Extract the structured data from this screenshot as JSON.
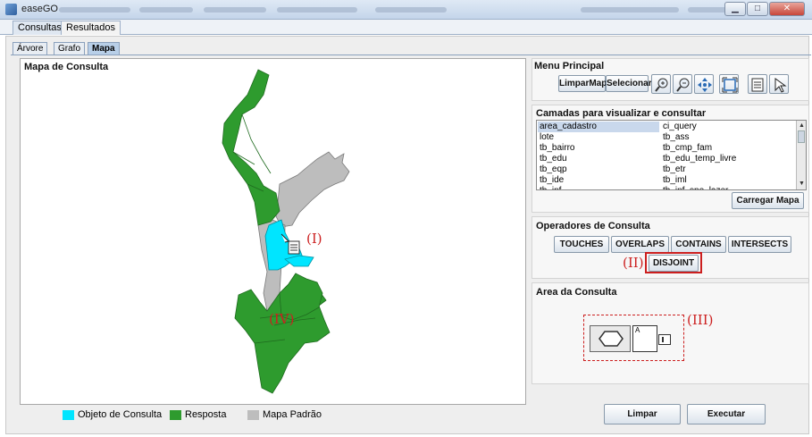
{
  "window": {
    "title": "easeGO"
  },
  "main_tabs": [
    {
      "label": "Consultas"
    },
    {
      "label": "Resultados"
    }
  ],
  "view_tabs": [
    {
      "label": "Árvore"
    },
    {
      "label": "Grafo"
    },
    {
      "label": "Mapa",
      "active": true
    }
  ],
  "map_panel": {
    "title": "Mapa de Consulta",
    "labels": {
      "query_object": "(I)",
      "answer": "(IV)"
    }
  },
  "legend": [
    {
      "label": "Objeto de Consulta",
      "color": "#00e5ff"
    },
    {
      "label": "Resposta",
      "color": "#2e9b2e"
    },
    {
      "label": "Mapa Padrão",
      "color": "#bdbdbd"
    }
  ],
  "menu_principal": {
    "title": "Menu Principal",
    "buttons": [
      {
        "label": "LimparMapa"
      },
      {
        "label": "Selecionar"
      }
    ],
    "tools": [
      {
        "icon": "zoom-in-icon"
      },
      {
        "icon": "zoom-out-icon"
      },
      {
        "icon": "pan-icon"
      },
      {
        "icon": "full-extent-icon"
      },
      {
        "icon": "layers-icon"
      },
      {
        "icon": "pointer-icon"
      }
    ]
  },
  "camadas": {
    "title": "Camadas para visualizar e consultar",
    "rows": [
      [
        "area_cadastro",
        "ci_query"
      ],
      [
        "lote",
        "tb_ass"
      ],
      [
        "tb_bairro",
        "tb_cmp_fam"
      ],
      [
        "tb_edu",
        "tb_edu_temp_livre"
      ],
      [
        "tb_eqp",
        "tb_etr"
      ],
      [
        "tb_ide",
        "tb_iml"
      ],
      [
        "tb_inf",
        "tb_inf_spo_lazer"
      ]
    ],
    "selected_row": 0,
    "load_button": "Carregar Mapa"
  },
  "operadores": {
    "title": "Operadores de Consulta",
    "buttons": [
      {
        "label": "TOUCHES"
      },
      {
        "label": "OVERLAPS"
      },
      {
        "label": "CONTAINS"
      },
      {
        "label": "INTERSECTS"
      }
    ],
    "disjoint": "DISJOINT",
    "marker": "(II)"
  },
  "area_consulta": {
    "title": "Area da Consulta",
    "marker": "(III)",
    "expr_leaf": "A"
  },
  "actions": {
    "clear": "Limpar",
    "execute": "Executar"
  }
}
